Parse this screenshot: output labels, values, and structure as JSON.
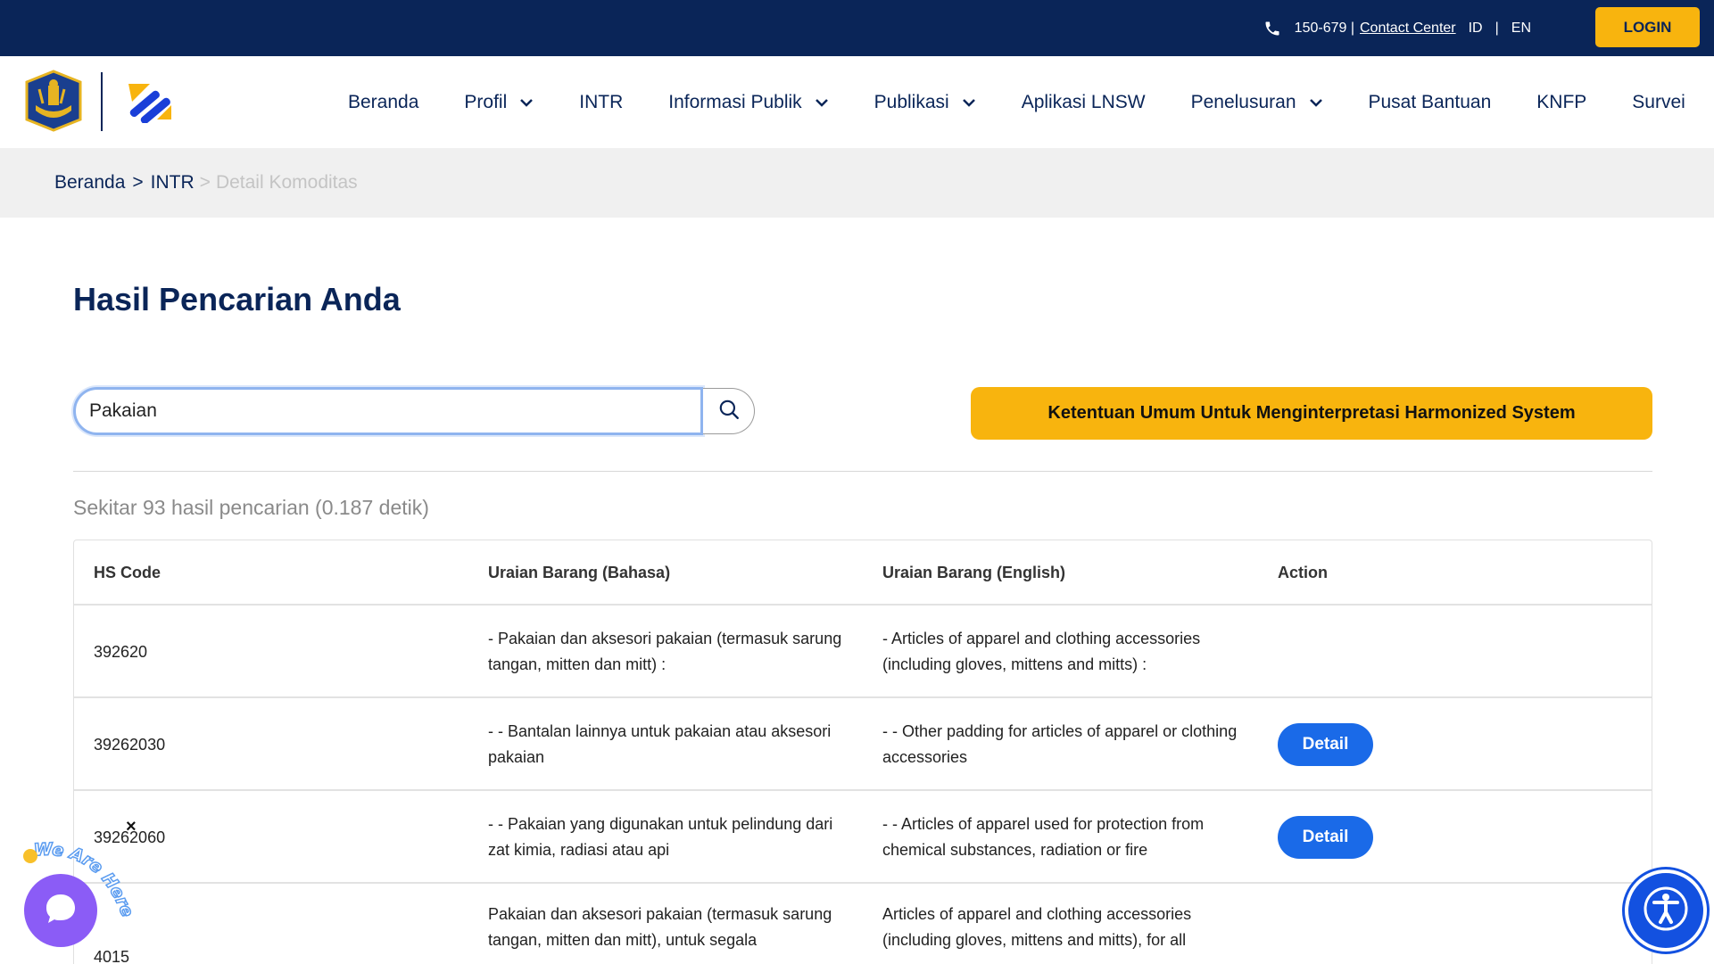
{
  "topbar": {
    "phone": "150-679 |",
    "contact_center": "Contact Center",
    "lang_id": "ID",
    "lang_sep": "|",
    "lang_en": "EN",
    "login": "LOGIN",
    "bg_color": "#0a2558",
    "accent_color": "#f8b40e"
  },
  "nav": {
    "items": [
      {
        "label": "Beranda",
        "dropdown": false
      },
      {
        "label": "Profil",
        "dropdown": true
      },
      {
        "label": "INTR",
        "dropdown": false
      },
      {
        "label": "Informasi Publik",
        "dropdown": true
      },
      {
        "label": "Publikasi",
        "dropdown": true
      },
      {
        "label": "Aplikasi LNSW",
        "dropdown": false
      },
      {
        "label": "Penelusuran",
        "dropdown": true
      },
      {
        "label": "Pusat Bantuan",
        "dropdown": false
      },
      {
        "label": "KNFP",
        "dropdown": false
      },
      {
        "label": "Survei",
        "dropdown": false
      }
    ]
  },
  "breadcrumb": {
    "home": "Beranda",
    "sep1": ">",
    "section": "INTR",
    "sep2": ">",
    "current": "Detail Komoditas"
  },
  "main": {
    "title": "Hasil Pencarian Anda",
    "search_value": "Pakaian",
    "hs_button": "Ketentuan Umum Untuk Menginterpretasi Harmonized System",
    "result_count": "Sekitar 93 hasil pencarian (0.187 detik)"
  },
  "table": {
    "headers": [
      "HS Code",
      "Uraian Barang (Bahasa)",
      "Uraian Barang (English)",
      "Action"
    ],
    "rows": [
      {
        "hs": "392620",
        "id": "- Pakaian dan aksesori pakaian (termasuk sarung tangan, mitten dan mitt) :",
        "en": "- Articles of apparel and clothing accessories (including gloves, mittens and mitts) :",
        "action": ""
      },
      {
        "hs": "39262030",
        "id": "- - Bantalan lainnya untuk pakaian atau aksesori pakaian",
        "en": "- - Other padding for articles of apparel or clothing accessories",
        "action": "Detail"
      },
      {
        "hs": "39262060",
        "id": "- - Pakaian yang digunakan untuk pelindung dari zat kimia, radiasi atau api",
        "en": "- - Articles of apparel used for protection from chemical substances, radiation or fire",
        "action": "Detail"
      },
      {
        "hs": "4015",
        "id": "Pakaian dan aksesori pakaian (termasuk sarung tangan, mitten dan mitt), untuk segala",
        "en": "Articles of apparel and clothing accessories (including gloves, mittens and mitts), for all",
        "action": ""
      }
    ]
  },
  "widgets": {
    "chat_label": "We Are Here!",
    "chat_close": "×",
    "chat_color": "#8b5cf6",
    "accessibility_color": "#1351e0"
  }
}
